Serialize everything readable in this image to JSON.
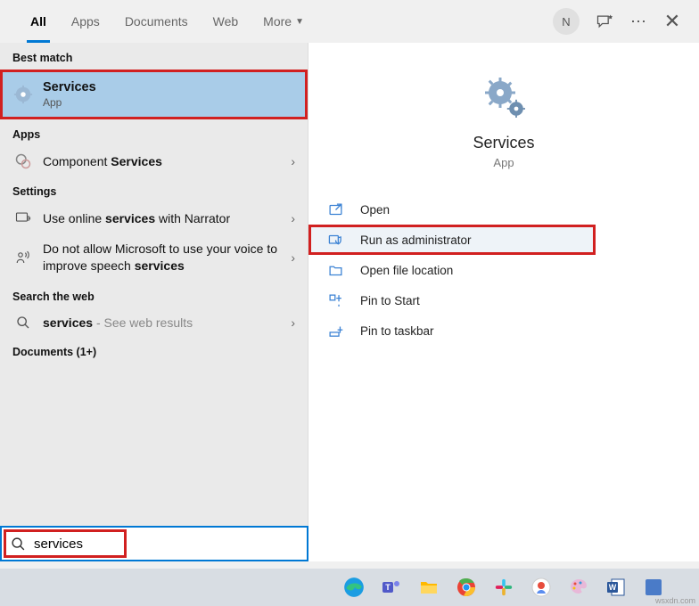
{
  "tabs": {
    "all": "All",
    "apps": "Apps",
    "documents": "Documents",
    "web": "Web",
    "more": "More"
  },
  "avatar_initial": "N",
  "left": {
    "best_match_label": "Best match",
    "best_match": {
      "title": "Services",
      "sub": "App"
    },
    "apps_label": "Apps",
    "apps": [
      {
        "pre": "Component ",
        "hl": "Services",
        "post": ""
      }
    ],
    "settings_label": "Settings",
    "settings": [
      {
        "pre": "Use online ",
        "hl": "services",
        "post": " with Narrator"
      },
      {
        "pre": "Do not allow Microsoft to use your voice to improve speech ",
        "hl": "services",
        "post": ""
      }
    ],
    "web_label": "Search the web",
    "web": [
      {
        "pre": "",
        "hl": "services",
        "post": " - See web results"
      }
    ],
    "documents_label": "Documents (1+)"
  },
  "right": {
    "title": "Services",
    "sub": "App",
    "actions": {
      "open": "Open",
      "run_admin": "Run as administrator",
      "open_loc": "Open file location",
      "pin_start": "Pin to Start",
      "pin_taskbar": "Pin to taskbar"
    }
  },
  "search": {
    "value": "services"
  },
  "watermark": "wsxdn.com"
}
